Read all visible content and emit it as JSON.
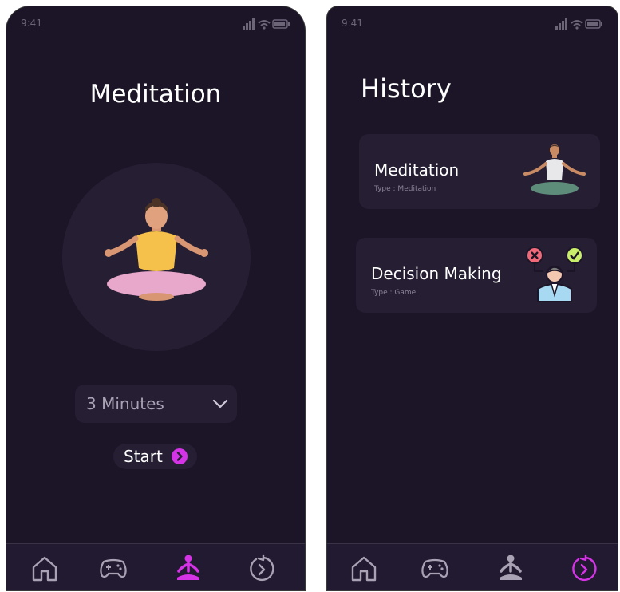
{
  "left_screen": {
    "status": {
      "time": "9:41"
    },
    "title": "Meditation",
    "duration_select": {
      "value": "3 Minutes"
    },
    "start_button": {
      "label": "Start"
    },
    "nav": [
      {
        "icon": "home-icon",
        "active": false
      },
      {
        "icon": "gamepad-icon",
        "active": false
      },
      {
        "icon": "meditation-icon",
        "active": true
      },
      {
        "icon": "history-icon",
        "active": false
      }
    ]
  },
  "right_screen": {
    "status": {
      "time": "9:41"
    },
    "title": "History",
    "items": [
      {
        "title": "Meditation",
        "type": "Type : Meditation",
        "icon": "meditating-man-icon"
      },
      {
        "title": "Decision Making",
        "type": "Type : Game",
        "icon": "decision-making-icon"
      }
    ],
    "nav": [
      {
        "icon": "home-icon",
        "active": false
      },
      {
        "icon": "gamepad-icon",
        "active": false
      },
      {
        "icon": "meditation-icon",
        "active": false
      },
      {
        "icon": "history-icon",
        "active": true
      }
    ]
  },
  "colors": {
    "background": "#1c1528",
    "surface": "#261e33",
    "accent": "#d534e6",
    "nav_inactive": "#a9a2b4"
  }
}
